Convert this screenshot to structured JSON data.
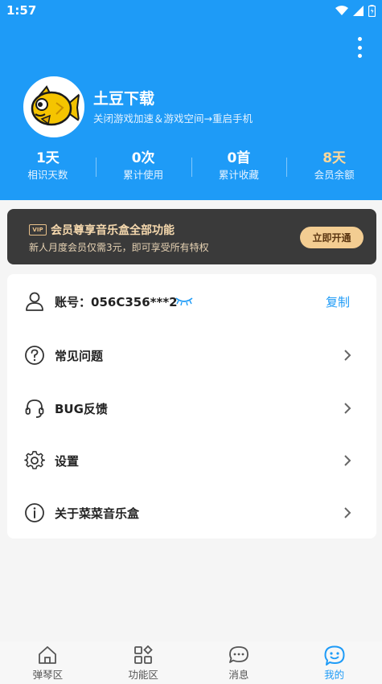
{
  "status_bar": {
    "time": "1:57"
  },
  "profile": {
    "name": "土豆下载",
    "subtitle": "关闭游戏加速＆游戏空间→重启手机"
  },
  "stats": [
    {
      "value": "1天",
      "label": "相识天数"
    },
    {
      "value": "0次",
      "label": "累计使用"
    },
    {
      "value": "0首",
      "label": "累计收藏"
    },
    {
      "value": "8天",
      "label": "会员余额"
    }
  ],
  "vip_banner": {
    "badge": "VIP",
    "title": "会员尊享音乐盒全部功能",
    "description": "新人月度会员仅需3元，即可享受所有特权",
    "button": "立即开通"
  },
  "account": {
    "label": "账号：",
    "value": "056C356***2",
    "copy": "复制"
  },
  "menu": [
    {
      "label": "常见问题",
      "icon": "help-circle-icon"
    },
    {
      "label": "BUG反馈",
      "icon": "headset-icon"
    },
    {
      "label": "设置",
      "icon": "gear-icon"
    },
    {
      "label": "关于菜菜音乐盒",
      "icon": "info-circle-icon"
    }
  ],
  "tabs": [
    {
      "label": "弹琴区",
      "icon": "home-icon"
    },
    {
      "label": "功能区",
      "icon": "grid-icon"
    },
    {
      "label": "消息",
      "icon": "chat-icon"
    },
    {
      "label": "我的",
      "icon": "profile-icon"
    }
  ],
  "colors": {
    "primary": "#1e9bf7",
    "vip_gold": "#f3cd92",
    "banner_dark": "#3a3a3a"
  }
}
